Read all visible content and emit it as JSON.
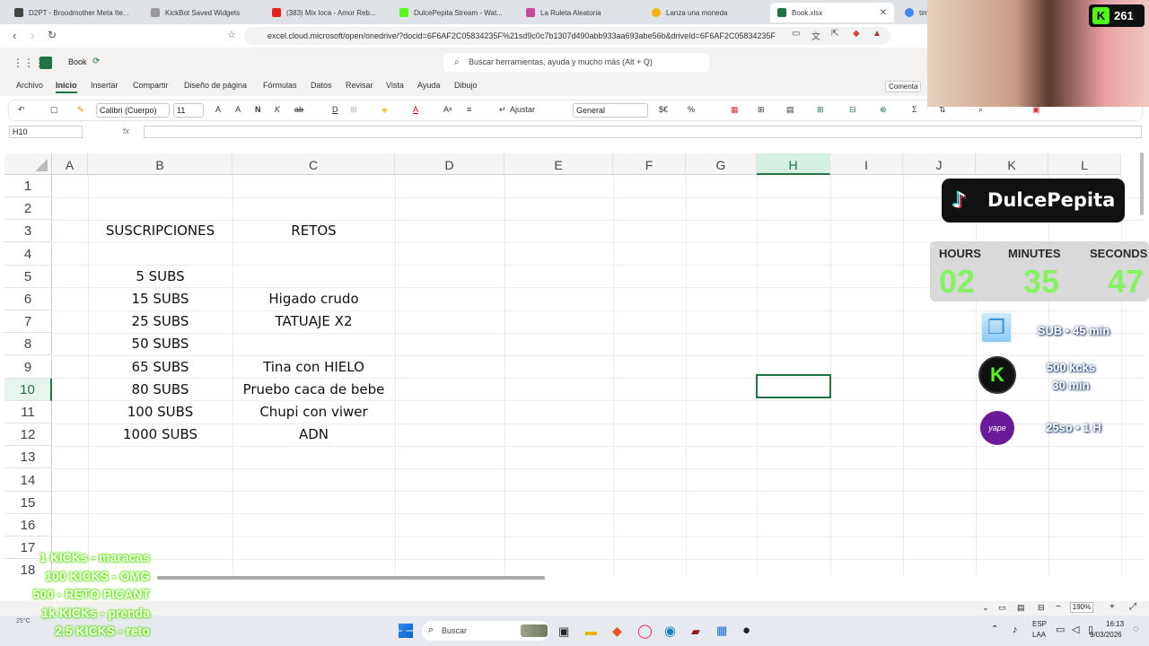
{
  "browser": {
    "tabs": [
      {
        "label": "D2PT - Broodmother Meta Ite..."
      },
      {
        "label": "KickBot Saved Widgets"
      },
      {
        "label": "(383) Mix loca - Amor Reb..."
      },
      {
        "label": "DulcePepita Stream - Wat..."
      },
      {
        "label": "La Ruleta Aleatoria"
      },
      {
        "label": "Lanza una moneda"
      },
      {
        "label": "Book.xlsx"
      },
      {
        "label": "tim"
      }
    ],
    "url": "excel.cloud.microsoft/open/onedrive/?docid=6F6AF2C05834235F%21sd9c0c7b1307d490abb933aa693abe56b&driveId=6F6AF2C05834235F"
  },
  "excel": {
    "doc_title": "Book",
    "search_placeholder": "Buscar herramientas, ayuda y mucho más (Alt + Q)",
    "menu": [
      "Archivo",
      "Inicio",
      "Insertar",
      "Compartir",
      "Diseño de página",
      "Fórmulas",
      "Datos",
      "Revisar",
      "Vista",
      "Ayuda",
      "Dibujo"
    ],
    "comments_label": "Comenta",
    "ribbon": {
      "font": "Calibri (Cuerpo)",
      "size": "11",
      "bold": "N",
      "italic": "K",
      "wrap": "Ajustar",
      "format": "General",
      "currency": "$€"
    },
    "namebox": "H10",
    "fx_label": "fx",
    "columns": [
      "A",
      "B",
      "C",
      "D",
      "E",
      "F",
      "G",
      "H",
      "I",
      "J",
      "K",
      "L"
    ],
    "rows": [
      "1",
      "2",
      "3",
      "4",
      "5",
      "6",
      "7",
      "8",
      "9",
      "10",
      "11",
      "12",
      "13",
      "14",
      "15",
      "16",
      "17",
      "18"
    ],
    "cells": {
      "B3": "SUSCRIPCIONES",
      "C3": "RETOS",
      "B5": "5 SUBS",
      "B6": "15 SUBS",
      "C6": "Higado crudo",
      "B7": "25 SUBS",
      "C7": "TATUAJE X2",
      "B8": "50 SUBS",
      "B9": "65 SUBS",
      "C9": "Tina con HIELO",
      "B10": "80 SUBS",
      "C10": "Pruebo caca de bebe",
      "B11": "100 SUBS",
      "C11": "Chupi con viwer",
      "B12": "1000 SUBS",
      "C12": "ADN"
    },
    "selected_cell": "H10",
    "zoom": "190%"
  },
  "overlay": {
    "kick_count": "261",
    "tiktok_name": "DulcePepita",
    "timer": {
      "hours_label": "HOURS",
      "minutes_label": "MINUTES",
      "seconds_label": "SECONDS",
      "hours": "02",
      "minutes": "35",
      "seconds": "47"
    },
    "goals": {
      "sub": "SUB • 45 min",
      "kicks_line1": "500 kcks",
      "kicks_line2": "30 min",
      "yape": "25so • 1 H",
      "yape_icon_text": "yape"
    },
    "kick_lines": [
      "1 KICKs - maracas",
      "100 KICKS - OMG",
      "500 - RETO PICANT",
      "1k KICKs - prenda",
      "2.5 KICKS - reto"
    ]
  },
  "taskbar": {
    "search": "Buscar",
    "lang1": "ESP",
    "lang2": "LAA",
    "time": "16:13",
    "date": "9/03/2026",
    "weather": "25°C"
  }
}
